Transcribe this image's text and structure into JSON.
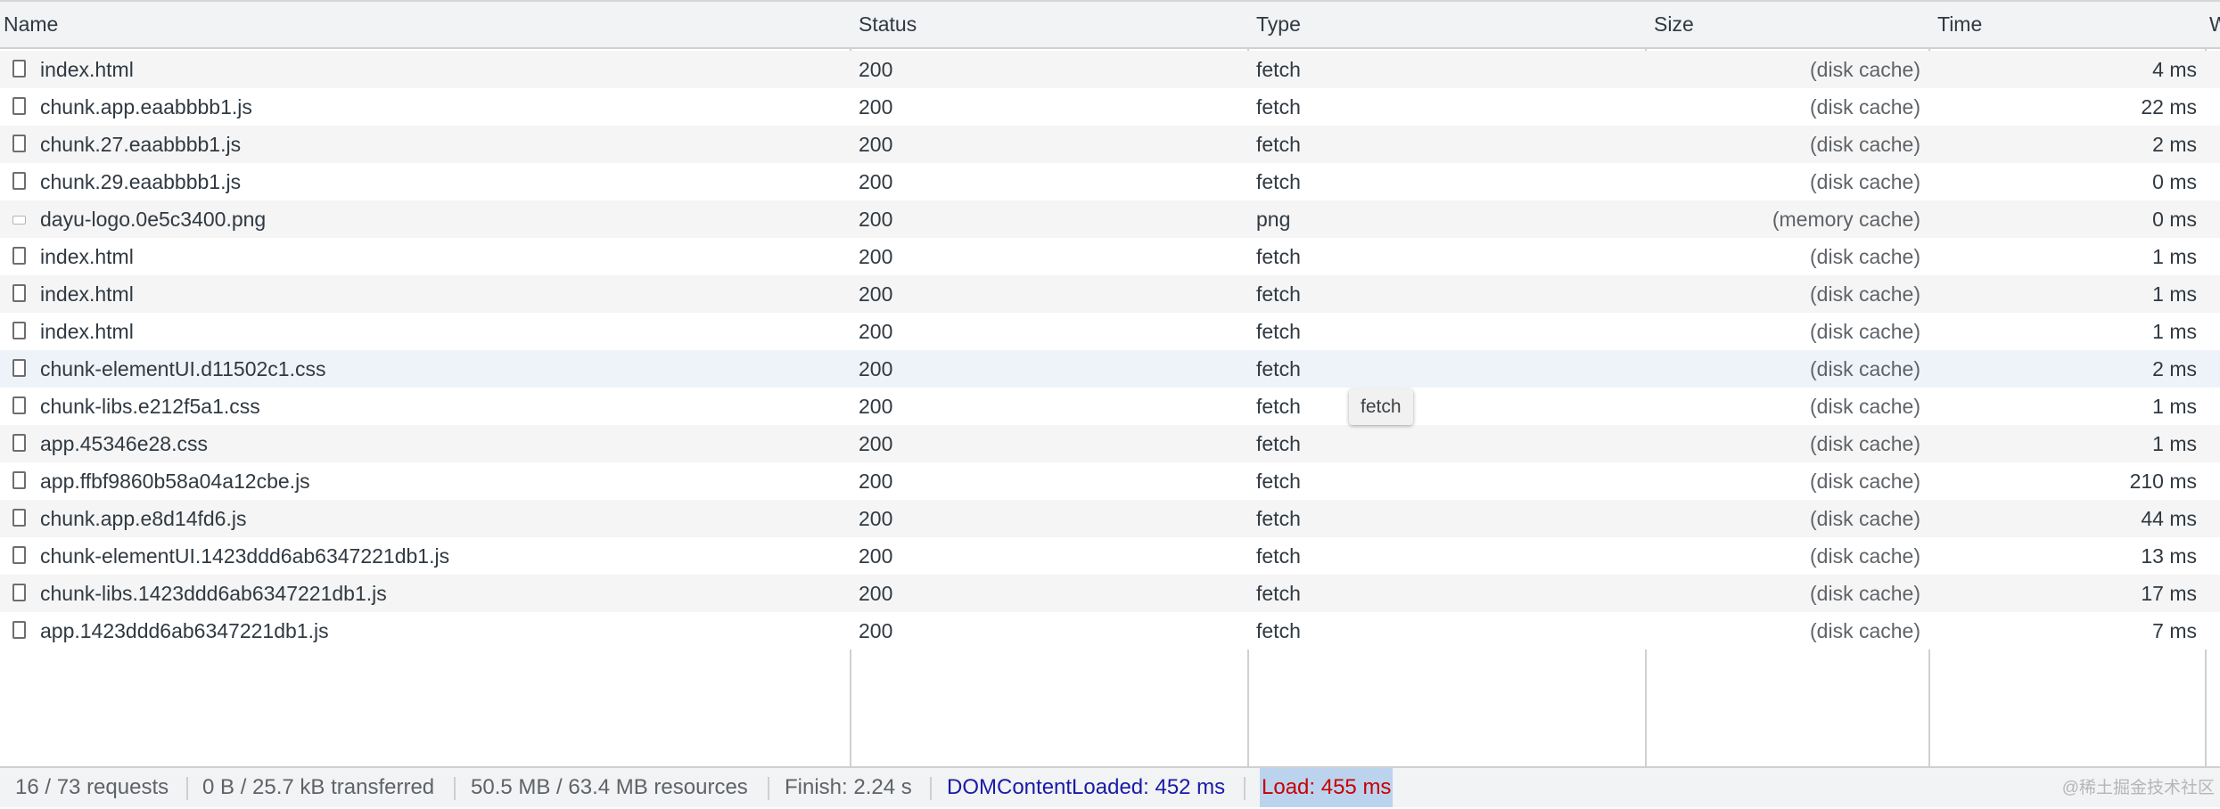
{
  "columns": {
    "name": "Name",
    "status": "Status",
    "type": "Type",
    "size": "Size",
    "time": "Time",
    "waterfall": "W"
  },
  "requests": [
    {
      "name": "index.html",
      "status": "200",
      "type": "fetch",
      "size": "(disk cache)",
      "time": "4 ms",
      "icon": "document-icon"
    },
    {
      "name": "chunk.app.eaabbbb1.js",
      "status": "200",
      "type": "fetch",
      "size": "(disk cache)",
      "time": "22 ms",
      "icon": "document-icon"
    },
    {
      "name": "chunk.27.eaabbbb1.js",
      "status": "200",
      "type": "fetch",
      "size": "(disk cache)",
      "time": "2 ms",
      "icon": "document-icon"
    },
    {
      "name": "chunk.29.eaabbbb1.js",
      "status": "200",
      "type": "fetch",
      "size": "(disk cache)",
      "time": "0 ms",
      "icon": "document-icon"
    },
    {
      "name": "dayu-logo.0e5c3400.png",
      "status": "200",
      "type": "png",
      "size": "(memory cache)",
      "time": "0 ms",
      "icon": "image-icon"
    },
    {
      "name": "index.html",
      "status": "200",
      "type": "fetch",
      "size": "(disk cache)",
      "time": "1 ms",
      "icon": "document-icon"
    },
    {
      "name": "index.html",
      "status": "200",
      "type": "fetch",
      "size": "(disk cache)",
      "time": "1 ms",
      "icon": "document-icon"
    },
    {
      "name": "index.html",
      "status": "200",
      "type": "fetch",
      "size": "(disk cache)",
      "time": "1 ms",
      "icon": "document-icon"
    },
    {
      "name": "chunk-elementUI.d11502c1.css",
      "status": "200",
      "type": "fetch",
      "size": "(disk cache)",
      "time": "2 ms",
      "icon": "document-icon"
    },
    {
      "name": "chunk-libs.e212f5a1.css",
      "status": "200",
      "type": "fetch",
      "size": "(disk cache)",
      "time": "1 ms",
      "icon": "document-icon"
    },
    {
      "name": "app.45346e28.css",
      "status": "200",
      "type": "fetch",
      "size": "(disk cache)",
      "time": "1 ms",
      "icon": "document-icon"
    },
    {
      "name": "app.ffbf9860b58a04a12cbe.js",
      "status": "200",
      "type": "fetch",
      "size": "(disk cache)",
      "time": "210 ms",
      "icon": "document-icon"
    },
    {
      "name": "chunk.app.e8d14fd6.js",
      "status": "200",
      "type": "fetch",
      "size": "(disk cache)",
      "time": "44 ms",
      "icon": "document-icon"
    },
    {
      "name": "chunk-elementUI.1423ddd6ab6347221db1.js",
      "status": "200",
      "type": "fetch",
      "size": "(disk cache)",
      "time": "13 ms",
      "icon": "document-icon"
    },
    {
      "name": "chunk-libs.1423ddd6ab6347221db1.js",
      "status": "200",
      "type": "fetch",
      "size": "(disk cache)",
      "time": "17 ms",
      "icon": "document-icon"
    },
    {
      "name": "app.1423ddd6ab6347221db1.js",
      "status": "200",
      "type": "fetch",
      "size": "(disk cache)",
      "time": "7 ms",
      "icon": "document-icon"
    }
  ],
  "tooltip": "fetch",
  "status_bar": {
    "requests": "16 / 73 requests",
    "transferred": "0 B / 25.7 kB transferred",
    "resources": "50.5 MB / 63.4 MB resources",
    "finish": "Finish: 2.24 s",
    "dom_content_loaded": "DOMContentLoaded: 452 ms",
    "load": "Load: 455 ms",
    "watermark": "@稀土掘金技术社区"
  },
  "colors": {
    "dom_content_loaded": "#1a1aa6",
    "load": "#c80000",
    "load_highlight": "#bcd3ee",
    "header_bg": "#f1f3f4",
    "row_stripe": "#f5f5f5"
  }
}
